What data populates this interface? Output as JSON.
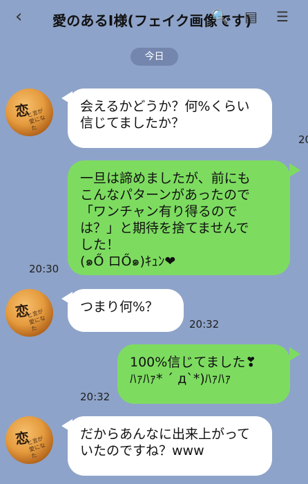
{
  "header": {
    "title": "愛のあるI様(フェイク画像です)"
  },
  "date_pill": "今日",
  "messages": [
    {
      "side": "left",
      "text": "会えるかどうか？何%くらい\n信じてましたか？",
      "time": "20"
    },
    {
      "side": "right",
      "text": "一旦は諦めましたが、前にも\nこんなパターンがあったので\n「ワンチャン有り得るので\nは？」と期待を捨てませんで\nした！\n(๑Ő ロŐ๑)ｷｭﾝ❤",
      "time": "20:30"
    },
    {
      "side": "left",
      "text": "つまり何%？",
      "time": "20:32"
    },
    {
      "side": "right",
      "text": "100%信じてました❣\nﾊｧﾊｧ* ´ д`*)ﾊｧﾊｧ",
      "time": "20:32"
    },
    {
      "side": "left",
      "text": "だからあんなに出来上がって\nいたのですね？www",
      "time": ""
    }
  ],
  "avatar": {
    "kanji": "恋",
    "small": "と言が\n愛になた"
  },
  "icons": [
    "back-chevron-icon",
    "search-icon",
    "note-icon",
    "menu-icon"
  ]
}
